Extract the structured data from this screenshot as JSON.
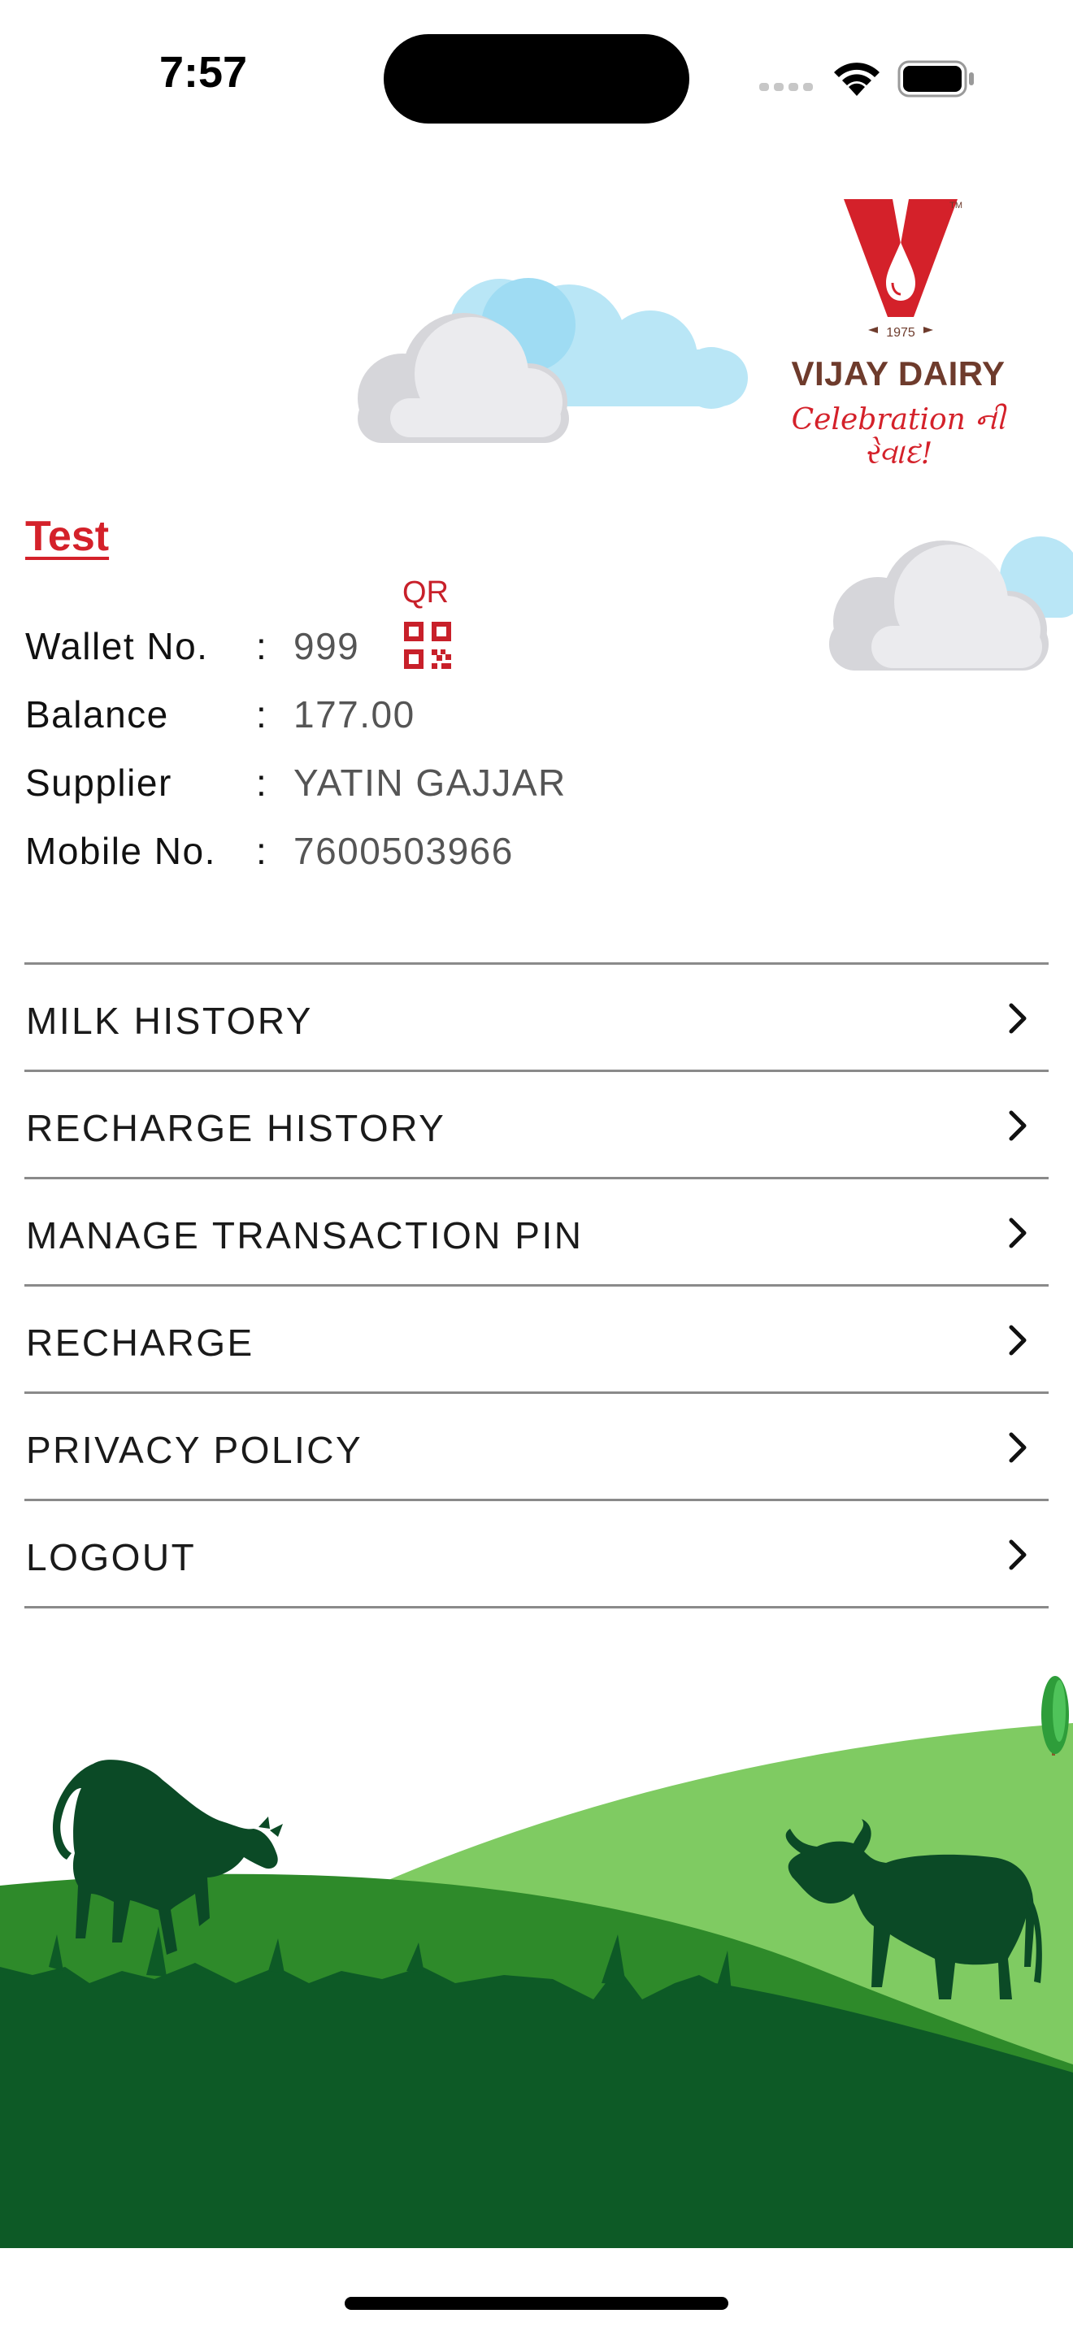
{
  "status_bar": {
    "time": "7:57"
  },
  "brand": {
    "logo_year": "1975",
    "name": "VIJAY DAIRY",
    "tagline": "Celebration ની રેવાદ!",
    "trademark": "TM",
    "colors": {
      "red": "#d4212a",
      "brown": "#6e3b2c"
    }
  },
  "profile": {
    "name": "Test",
    "qr_label": "QR",
    "fields": [
      {
        "label": "Wallet No.",
        "value": "999"
      },
      {
        "label": "Balance",
        "value": "177.00"
      },
      {
        "label": "Supplier",
        "value": "YATIN GAJJAR"
      },
      {
        "label": "Mobile No.",
        "value": "7600503966"
      }
    ],
    "separator": ":"
  },
  "menu": {
    "items": [
      {
        "label": "MILK HISTORY",
        "icon": "chevron-right-icon"
      },
      {
        "label": "RECHARGE HISTORY",
        "icon": "chevron-right-icon"
      },
      {
        "label": "MANAGE TRANSACTION PIN",
        "icon": "chevron-right-icon"
      },
      {
        "label": "RECHARGE",
        "icon": "chevron-right-icon"
      },
      {
        "label": "PRIVACY POLICY",
        "icon": "chevron-right-icon"
      },
      {
        "label": "LOGOUT",
        "icon": "chevron-right-icon"
      }
    ]
  },
  "theme": {
    "accent": "#d4212a",
    "grass_light": "#7fcb62",
    "grass_mid": "#2e8a2a",
    "grass_dark": "#0d5a26",
    "cow": "#0b4a26"
  }
}
